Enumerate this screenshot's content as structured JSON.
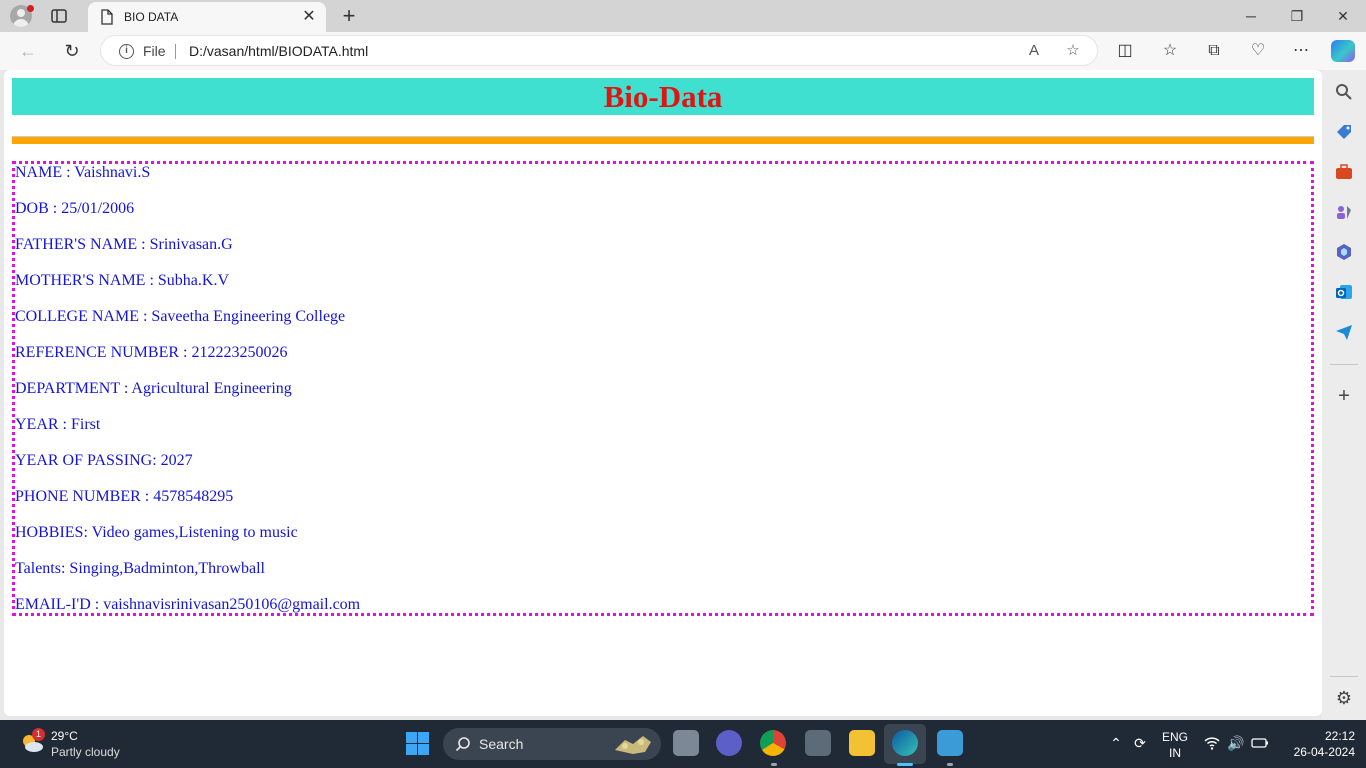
{
  "browser": {
    "tab_title": "BIO DATA",
    "url_scheme_label": "File",
    "url": "D:/vasan/html/BIODATA.html"
  },
  "page": {
    "heading": "Bio-Data",
    "colors": {
      "heading_bg": "#40e0d0",
      "heading_text": "#e11414",
      "divider": "#ffa500",
      "box_border": "#e010e0",
      "body_text": "#1414d8"
    },
    "bio_lines": [
      "NAME : Vaishnavi.S",
      "DOB : 25/01/2006",
      "FATHER'S NAME : Srinivasan.G",
      "MOTHER'S NAME : Subha.K.V",
      "COLLEGE NAME : Saveetha Engineering College",
      "REFERENCE NUMBER : 212223250026",
      "DEPARTMENT : Agricultural Engineering",
      "YEAR : First",
      "YEAR OF PASSING: 2027",
      "PHONE NUMBER : 4578548295",
      "HOBBIES: Video games,Listening to music",
      "Talents: Singing,Badminton,Throwball",
      "EMAIL-I'D : vaishnavisrinivasan250106@gmail.com"
    ]
  },
  "taskbar": {
    "weather_badge": "1",
    "weather_temp": "29°C",
    "weather_desc": "Partly cloudy",
    "search_label": "Search",
    "language_top": "ENG",
    "language_bottom": "IN",
    "time": "22:12",
    "date": "26-04-2024"
  }
}
